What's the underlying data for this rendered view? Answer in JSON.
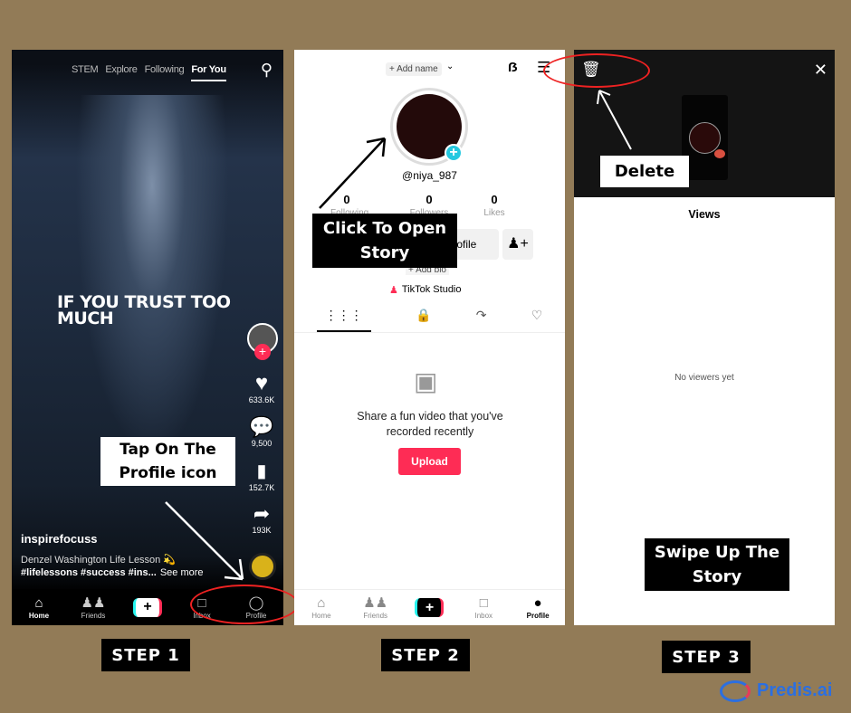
{
  "step1": {
    "tabs": [
      "STEM",
      "Explore",
      "Following",
      "For You"
    ],
    "overlay_text": "IF YOU TRUST TOO MUCH",
    "likes": "633.6K",
    "comments": "9,500",
    "saves": "152.7K",
    "shares": "193K",
    "username": "inspirefocuss",
    "caption": "Denzel Washington Life Lesson 💫",
    "hashtags": "#lifelessons #success #ins...",
    "see_more": "See more",
    "nav": [
      "Home",
      "Friends",
      "",
      "Inbox",
      "Profile"
    ],
    "callout": "Tap On The Profile icon",
    "label": "STEP 1"
  },
  "step2": {
    "add_name": "+ Add name",
    "handle": "@niya_987",
    "stats": [
      {
        "value": "0",
        "label": "Following"
      },
      {
        "value": "0",
        "label": "Followers"
      },
      {
        "value": "0",
        "label": "Likes"
      }
    ],
    "edit_profile": "Edit profile",
    "add_bio": "+ Add bio",
    "studio": "TikTok Studio",
    "empty_text": "Share a fun video that you've recorded recently",
    "upload": "Upload",
    "nav": [
      "Home",
      "Friends",
      "",
      "Inbox",
      "Profile"
    ],
    "callout": "Click To Open Story",
    "label": "STEP 2"
  },
  "step3": {
    "views_title": "Views",
    "no_viewers": "No viewers yet",
    "delete_callout": "Delete",
    "swipe_callout": "Swipe Up The Story",
    "label": "STEP 3"
  },
  "brand": {
    "name": "Predis.ai"
  },
  "colors": {
    "background": "#927b57",
    "tiktok_red": "#fe2c55",
    "annotation_red": "#e22222",
    "accent_cyan": "#25c8e0",
    "brand_blue": "#2c6fe0"
  }
}
